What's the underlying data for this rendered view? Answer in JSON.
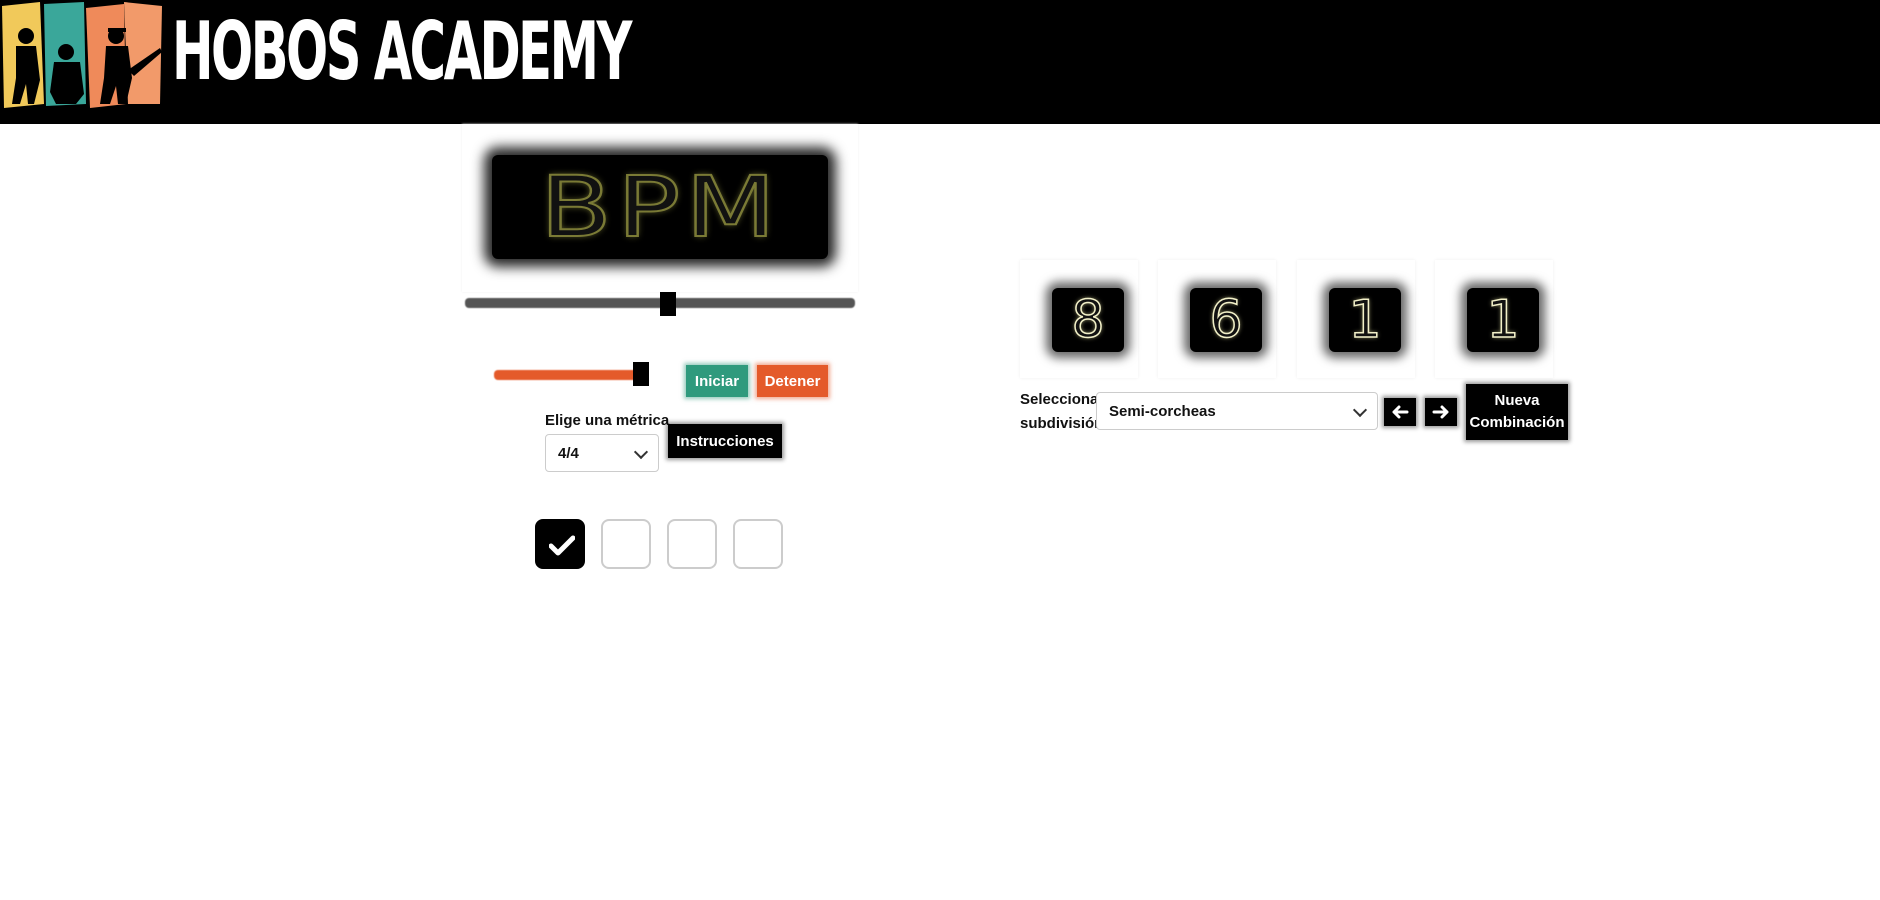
{
  "header": {
    "brand": "HoBos Academy",
    "brand_display": "HOBOS ACADEMY",
    "logo_colors": [
      "#f1c95a",
      "#3aa79a",
      "#ef8a5a",
      "#f29a6a"
    ]
  },
  "metronome": {
    "display_text": "BPM",
    "tempo_slider_level": 0.52,
    "volume_slider_level": 0.92,
    "start_label": "Iniciar",
    "stop_label": "Detener",
    "metric_label": "Elige una métrica",
    "metric_value": "4/4",
    "instructions_label": "Instrucciones",
    "beats": [
      {
        "active": true
      },
      {
        "active": false
      },
      {
        "active": false
      },
      {
        "active": false
      }
    ]
  },
  "combination": {
    "digits": [
      "8",
      "6",
      "1",
      "1"
    ],
    "subdivision_label": "Selecciona subdivisión",
    "subdivision_value": "Semi-corcheas",
    "prev_icon": "arrow-left-icon",
    "next_icon": "arrow-right-icon",
    "new_combination_line1": "Nueva",
    "new_combination_line2": "Combinación"
  },
  "colors": {
    "start": "#2f9a7d",
    "stop": "#e45a2a",
    "digit_glow": "#f2f0c8",
    "bpm_glow": "#7a7a35"
  }
}
